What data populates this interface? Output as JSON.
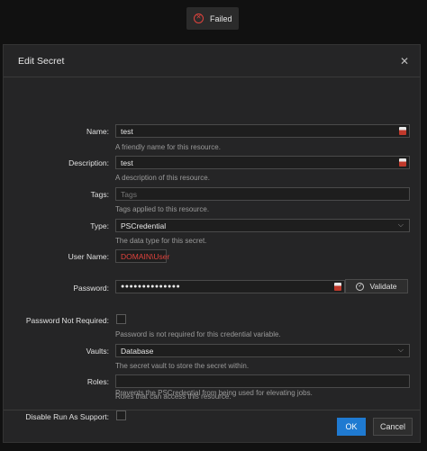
{
  "toast": {
    "text": "Failed",
    "icon": "x-circle-icon",
    "color": "#e0433d"
  },
  "modal": {
    "title": "Edit Secret",
    "fields": {
      "name": {
        "label": "Name:",
        "value": "test",
        "help": "A friendly name for this resource."
      },
      "description": {
        "label": "Description:",
        "value": "test",
        "help": "A description of this resource."
      },
      "tags": {
        "label": "Tags:",
        "placeholder": "Tags",
        "help": "Tags applied to this resource."
      },
      "type": {
        "label": "Type:",
        "value": "PSCredential",
        "help": "The data type for this secret."
      },
      "user_name": {
        "label": "User Name:",
        "value": "DOMAIN\\User",
        "value_color": "#e0433d"
      },
      "password": {
        "label": "Password:",
        "value": "●●●●●●●●●●●●●●",
        "validate_label": "Validate"
      },
      "password_not_required": {
        "label": "Password Not Required:",
        "help": "Password is not required for this credential variable."
      },
      "vaults": {
        "label": "Vaults:",
        "value": "Database",
        "help": "The secret vault to store the secret within."
      },
      "roles": {
        "label": "Roles:",
        "help": "Roles that can access this resource."
      },
      "disable_run_as_support": {
        "label": "Disable Run As Support:",
        "help": "Prevents the PSCredential from being used for elevating jobs."
      }
    },
    "footer": {
      "ok_label": "OK",
      "cancel_label": "Cancel"
    }
  },
  "colors": {
    "accent": "#1f7ad1",
    "error": "#e0433d"
  }
}
